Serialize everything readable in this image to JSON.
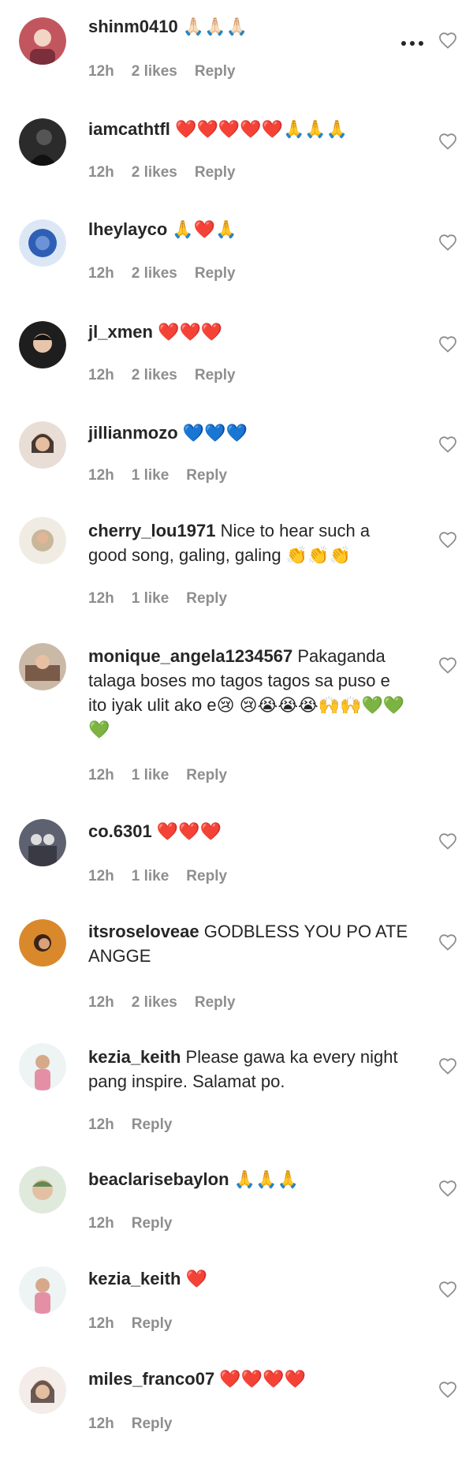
{
  "comments": [
    {
      "username": "shinm0410",
      "text": "🙏🏻🙏🏻🙏🏻",
      "time": "12h",
      "likes": "2 likes",
      "reply": "Reply",
      "avatar_color": "#c2565e",
      "more_icon": true
    },
    {
      "username": "iamcathtfl",
      "text": "❤️❤️❤️❤️❤️🙏🙏🙏",
      "time": "12h",
      "likes": "2 likes",
      "reply": "Reply",
      "avatar_color": "#2b2b2b"
    },
    {
      "username": "lheylayco",
      "text": "🙏❤️🙏",
      "time": "12h",
      "likes": "2 likes",
      "reply": "Reply",
      "avatar_color": "#2f5fb5"
    },
    {
      "username": "jl_xmen",
      "text": "❤️❤️❤️",
      "time": "12h",
      "likes": "2 likes",
      "reply": "Reply",
      "avatar_color": "#1e1e1e"
    },
    {
      "username": "jillianmozo",
      "text": "💙💙💙",
      "time": "12h",
      "likes": "1 like",
      "reply": "Reply",
      "avatar_color": "#b48a72"
    },
    {
      "username": "cherry_lou1971",
      "text": "Nice to hear such a good song, galing, galing 👏👏👏",
      "time": "12h",
      "likes": "1 like",
      "reply": "Reply",
      "avatar_color": "#c9b79a"
    },
    {
      "username": "monique_angela1234567",
      "text": "Pakaganda talaga boses mo tagos tagos sa puso e ito iyak ulit ako e😢 😢😭😭😭🙌🙌💚💚💚",
      "time": "12h",
      "likes": "1 like",
      "reply": "Reply",
      "avatar_color": "#7a5a48"
    },
    {
      "username": "co.6301",
      "text": "❤️❤️❤️",
      "time": "12h",
      "likes": "1 like",
      "reply": "Reply",
      "avatar_color": "#3a3a44"
    },
    {
      "username": "itsroseloveae",
      "text": "GODBLESS YOU PO ATE ANGGE",
      "time": "12h",
      "likes": "2 likes",
      "reply": "Reply",
      "avatar_color": "#d9892b"
    },
    {
      "username": "kezia_keith",
      "text": "Please gawa ka every night pang inspire. Salamat po.",
      "time": "12h",
      "likes": "",
      "reply": "Reply",
      "avatar_color": "#8fc3cf"
    },
    {
      "username": "beaclarisebaylon",
      "text": "🙏🙏🙏",
      "time": "12h",
      "likes": "",
      "reply": "Reply",
      "avatar_color": "#5f8a52"
    },
    {
      "username": "kezia_keith",
      "text": "❤️",
      "time": "12h",
      "likes": "",
      "reply": "Reply",
      "avatar_color": "#8fc3cf"
    },
    {
      "username": "miles_franco07",
      "text": "❤️❤️❤️❤️",
      "time": "12h",
      "likes": "",
      "reply": "Reply",
      "avatar_color": "#5a4a46"
    }
  ],
  "icons": {
    "like": "heart-outline-icon",
    "more": "more-horizontal-icon"
  },
  "colors": {
    "text": "#262626",
    "secondary": "#8e8e8e",
    "background": "#ffffff"
  }
}
